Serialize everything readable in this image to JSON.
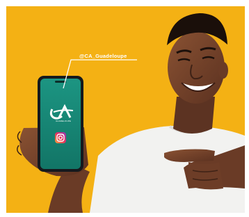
{
  "social": {
    "handle": "@CA_Guadeloupe",
    "platform_icon": "instagram-icon"
  },
  "brand": {
    "logo_text": "CA",
    "logo_tagline": "GUADELOUPE"
  },
  "colors": {
    "background": "#f4b114",
    "phone_screen": "#18897a",
    "shirt": "#f2f2f0"
  }
}
